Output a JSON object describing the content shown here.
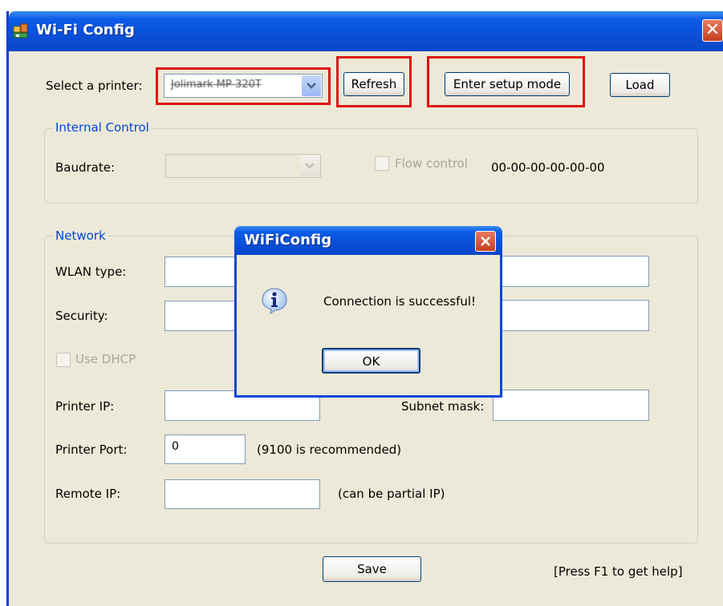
{
  "window": {
    "title": "Wi-Fi Config",
    "close_glyph": "✕"
  },
  "printer": {
    "label": "Select a printer:",
    "selected": "Jolimark MP-320T",
    "refresh_label": "Refresh",
    "setup_label": "Enter setup mode",
    "load_label": "Load"
  },
  "internal_control": {
    "legend": "Internal Control",
    "baudrate_label": "Baudrate:",
    "baudrate_value": "",
    "flow_control_label": "Flow control",
    "mac": "00-00-00-00-00-00"
  },
  "network": {
    "legend": "Network",
    "wlan_type_label": "WLAN type:",
    "security_label": "Security:",
    "use_dhcp_label": "Use DHCP",
    "printer_ip_label": "Printer IP:",
    "subnet_mask_label": "Subnet mask:",
    "printer_port_label": "Printer Port:",
    "printer_port_value": "0",
    "port_hint": "(9100 is recommended)",
    "remote_ip_label": "Remote IP:",
    "remote_ip_hint": "(can be partial IP)"
  },
  "footer": {
    "save_label": "Save",
    "help_text": "[Press F1 to get help]"
  },
  "dialog": {
    "title": "WiFiConfig",
    "message": "Connection is successful!",
    "ok_label": "OK"
  },
  "icons": [
    "app-icon",
    "close-icon",
    "chevron-down-icon",
    "info-icon"
  ],
  "colors": {
    "titlebar": "#0a50d8",
    "window_bg": "#ece9d8",
    "highlight": "#e01010",
    "group_legend": "#0046d5"
  }
}
